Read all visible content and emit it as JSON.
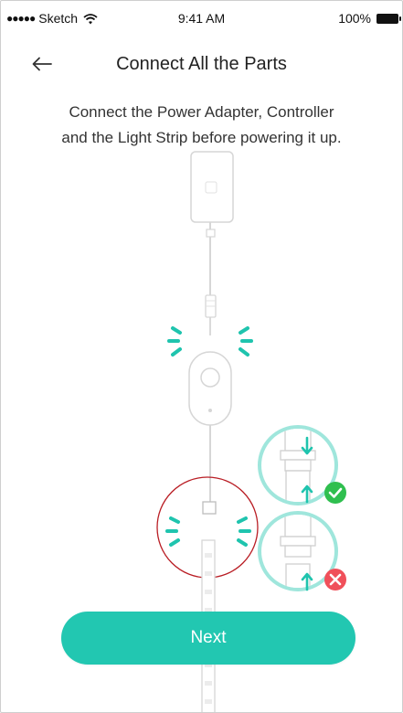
{
  "status_bar": {
    "dots": "●●●●●",
    "carrier": "Sketch",
    "time": "9:41 AM",
    "battery": "100%"
  },
  "nav": {
    "back_icon": "arrow-left-icon",
    "title": "Connect All the Parts"
  },
  "instructions": {
    "line1": "Connect the Power Adapter, Controller",
    "line2": "and the Light Strip before powering it up."
  },
  "illustration": {
    "accent_color": "#1fc4ae",
    "highlight_ring_color": "#b91d24",
    "correct_badge_color": "#2fbf4f",
    "wrong_badge_color": "#f0505a",
    "correct_icon": "check-icon",
    "wrong_icon": "cross-icon"
  },
  "actions": {
    "next_label": "Next",
    "next_color": "#22c7b1"
  }
}
